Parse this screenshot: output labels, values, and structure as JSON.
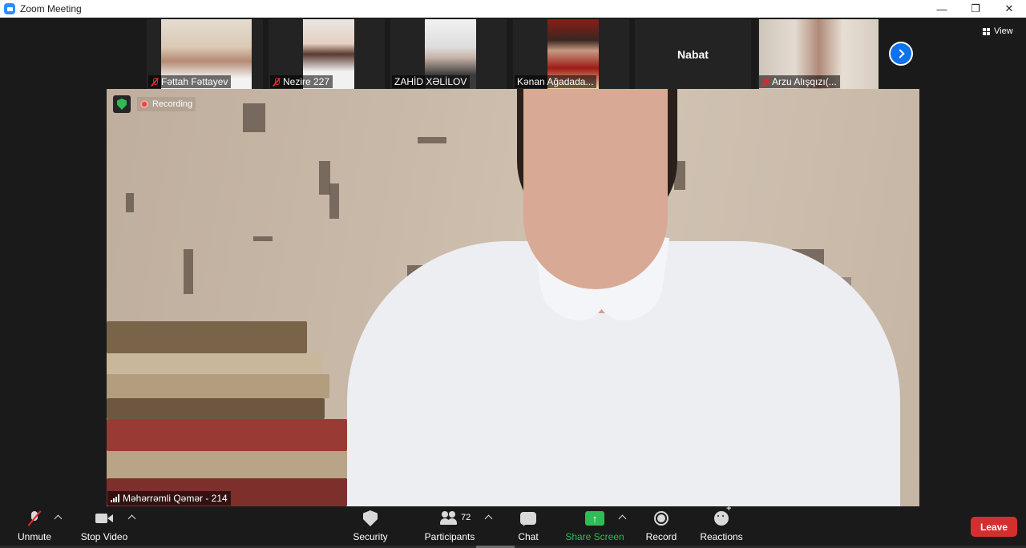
{
  "window": {
    "title": "Zoom Meeting",
    "controls": [
      "minimize",
      "restore",
      "close"
    ]
  },
  "gallery": {
    "participants": [
      {
        "name": "Fəttah Fəttayev",
        "muted": true,
        "has_video": true
      },
      {
        "name": "Nezire 227",
        "muted": true,
        "has_video": true
      },
      {
        "name": "ZAHİD XƏLİLOV",
        "muted": false,
        "has_video": true
      },
      {
        "name": "Kənan Ağadada...",
        "muted": false,
        "has_video": true
      },
      {
        "name": "Nabat",
        "muted": false,
        "has_video": false
      },
      {
        "name": "Arzu Alışqızı(...",
        "muted": true,
        "has_video": true
      }
    ],
    "next_page_icon": "chevron-right-icon",
    "view_label": "View"
  },
  "main_video": {
    "recording_label": "Recording",
    "speaker_name": "Məhərrəmli Qəmər - 214",
    "encryption_icon": "shield-check-icon"
  },
  "toolbar": {
    "unmute_label": "Unmute",
    "stop_video_label": "Stop Video",
    "security_label": "Security",
    "participants_label": "Participants",
    "participants_count": "72",
    "chat_label": "Chat",
    "share_screen_label": "Share Screen",
    "record_label": "Record",
    "reactions_label": "Reactions",
    "leave_label": "Leave"
  },
  "colors": {
    "accent": "#0e72ed",
    "share_green": "#2fbc56",
    "leave_red": "#d42f2f",
    "muted_red": "#e02828",
    "background": "#1a1a1a"
  }
}
